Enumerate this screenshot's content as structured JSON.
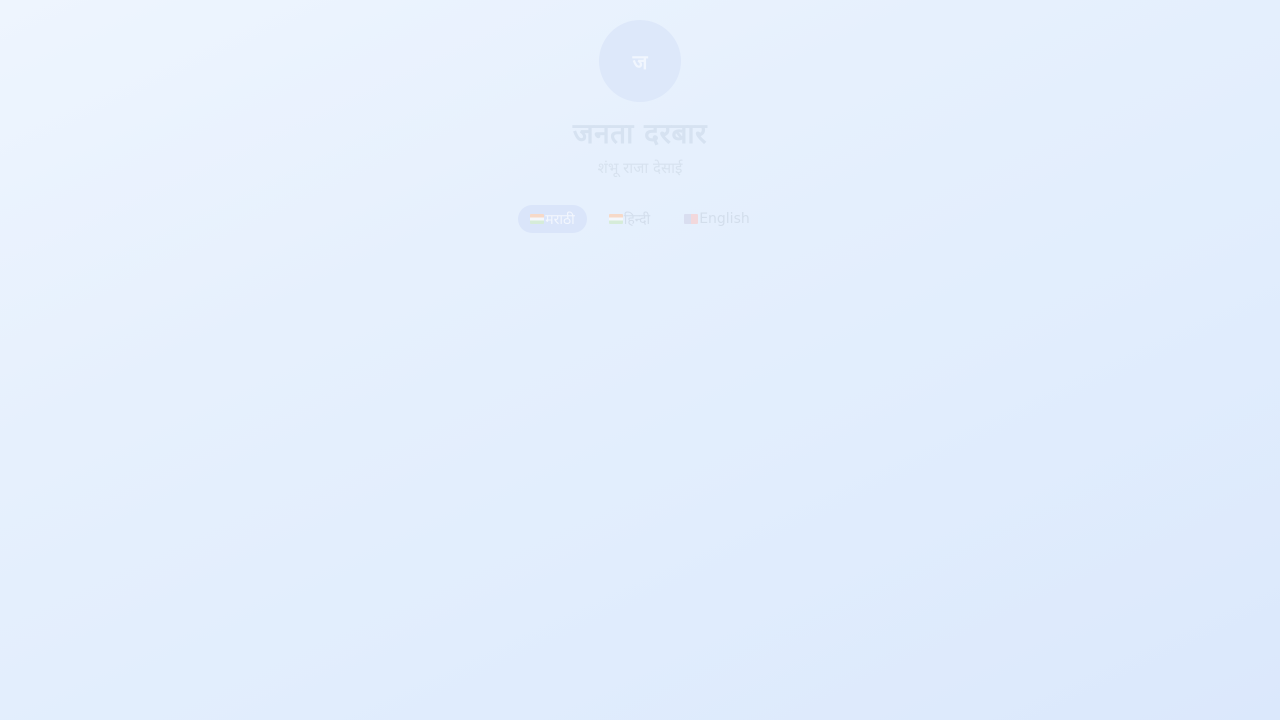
{
  "profile": {
    "avatar_initial": "ज",
    "title": "जनता दरबार",
    "subtitle": "शंभू राजा देसाई"
  },
  "language_switcher": {
    "options": [
      {
        "flag_icon": "india-flag-icon",
        "label": "मराठी",
        "active": true
      },
      {
        "flag_icon": "india-flag-icon",
        "label": "हिन्दी",
        "active": false
      },
      {
        "flag_icon": "uk-flag-icon",
        "label": "English",
        "active": false
      }
    ]
  },
  "colors": {
    "background_start": "#eef5fe",
    "background_end": "#dbe8fc",
    "avatar_bg": "#dde8fa",
    "active_pill_bg": "#dae5fa"
  }
}
